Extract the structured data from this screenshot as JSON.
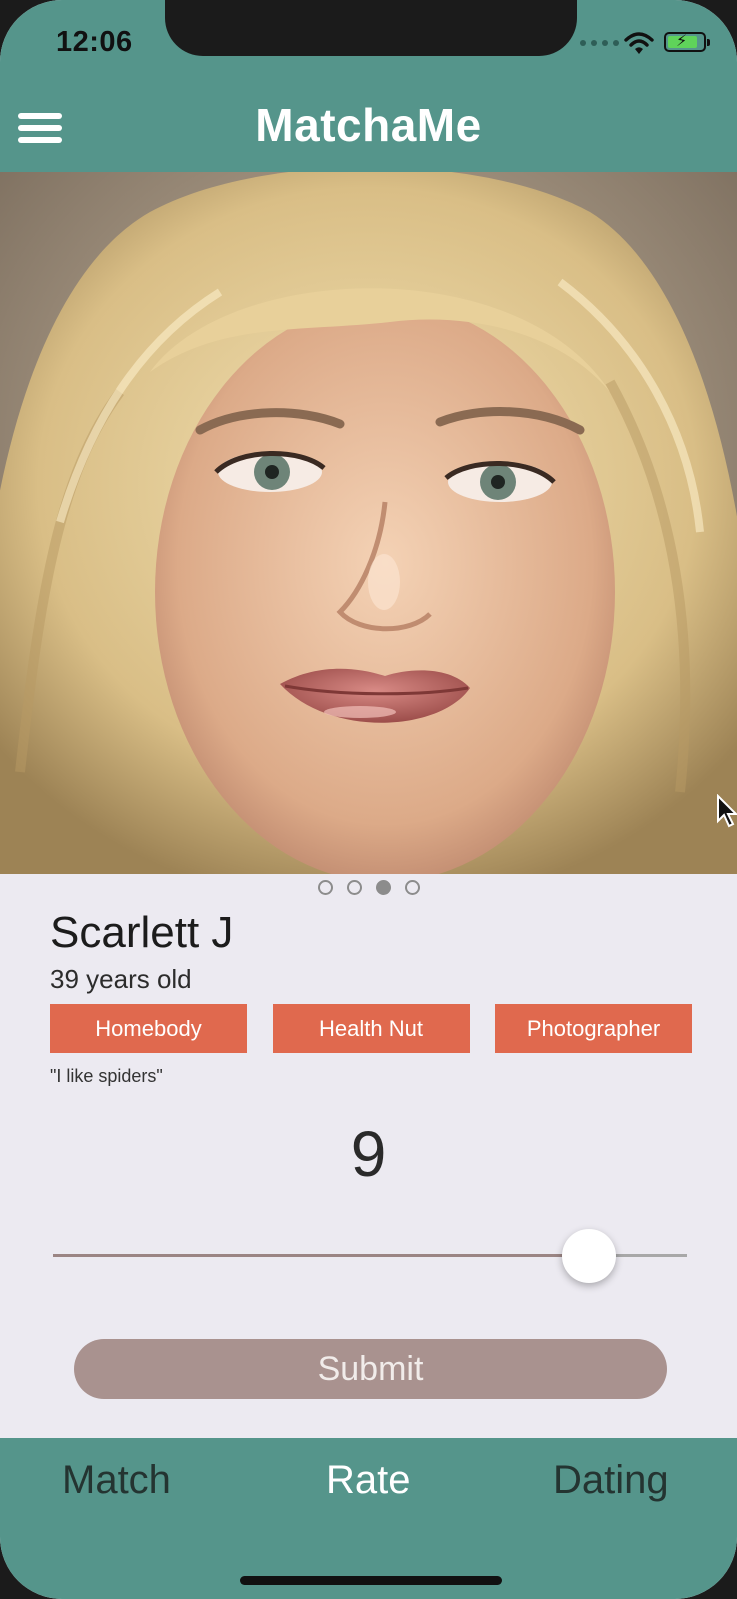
{
  "status_bar": {
    "time": "12:06",
    "icons": [
      "signal-dots-icon",
      "wifi-icon",
      "battery-charging-icon"
    ]
  },
  "header": {
    "title": "MatchaMe",
    "menu_icon": "hamburger-menu-icon"
  },
  "colors": {
    "header_bg": "#55958b",
    "tag_bg": "#e0694e",
    "submit_bg": "#a9928f",
    "active_tab": "#ffffff",
    "inactive_tab": "#243431",
    "background": "#eceaf1"
  },
  "profile": {
    "photo_count": 4,
    "active_photo_index": 2,
    "name": "Scarlett J",
    "age": "39 years old",
    "tags": [
      "Homebody",
      "Health Nut",
      "Photographer"
    ],
    "quote": "\"I like spiders\""
  },
  "rating": {
    "value": "9",
    "slider_fraction": 0.845
  },
  "submit_label": "Submit",
  "tabs": [
    {
      "label": "Match",
      "active": false
    },
    {
      "label": "Rate",
      "active": true
    },
    {
      "label": "Dating",
      "active": false
    }
  ]
}
